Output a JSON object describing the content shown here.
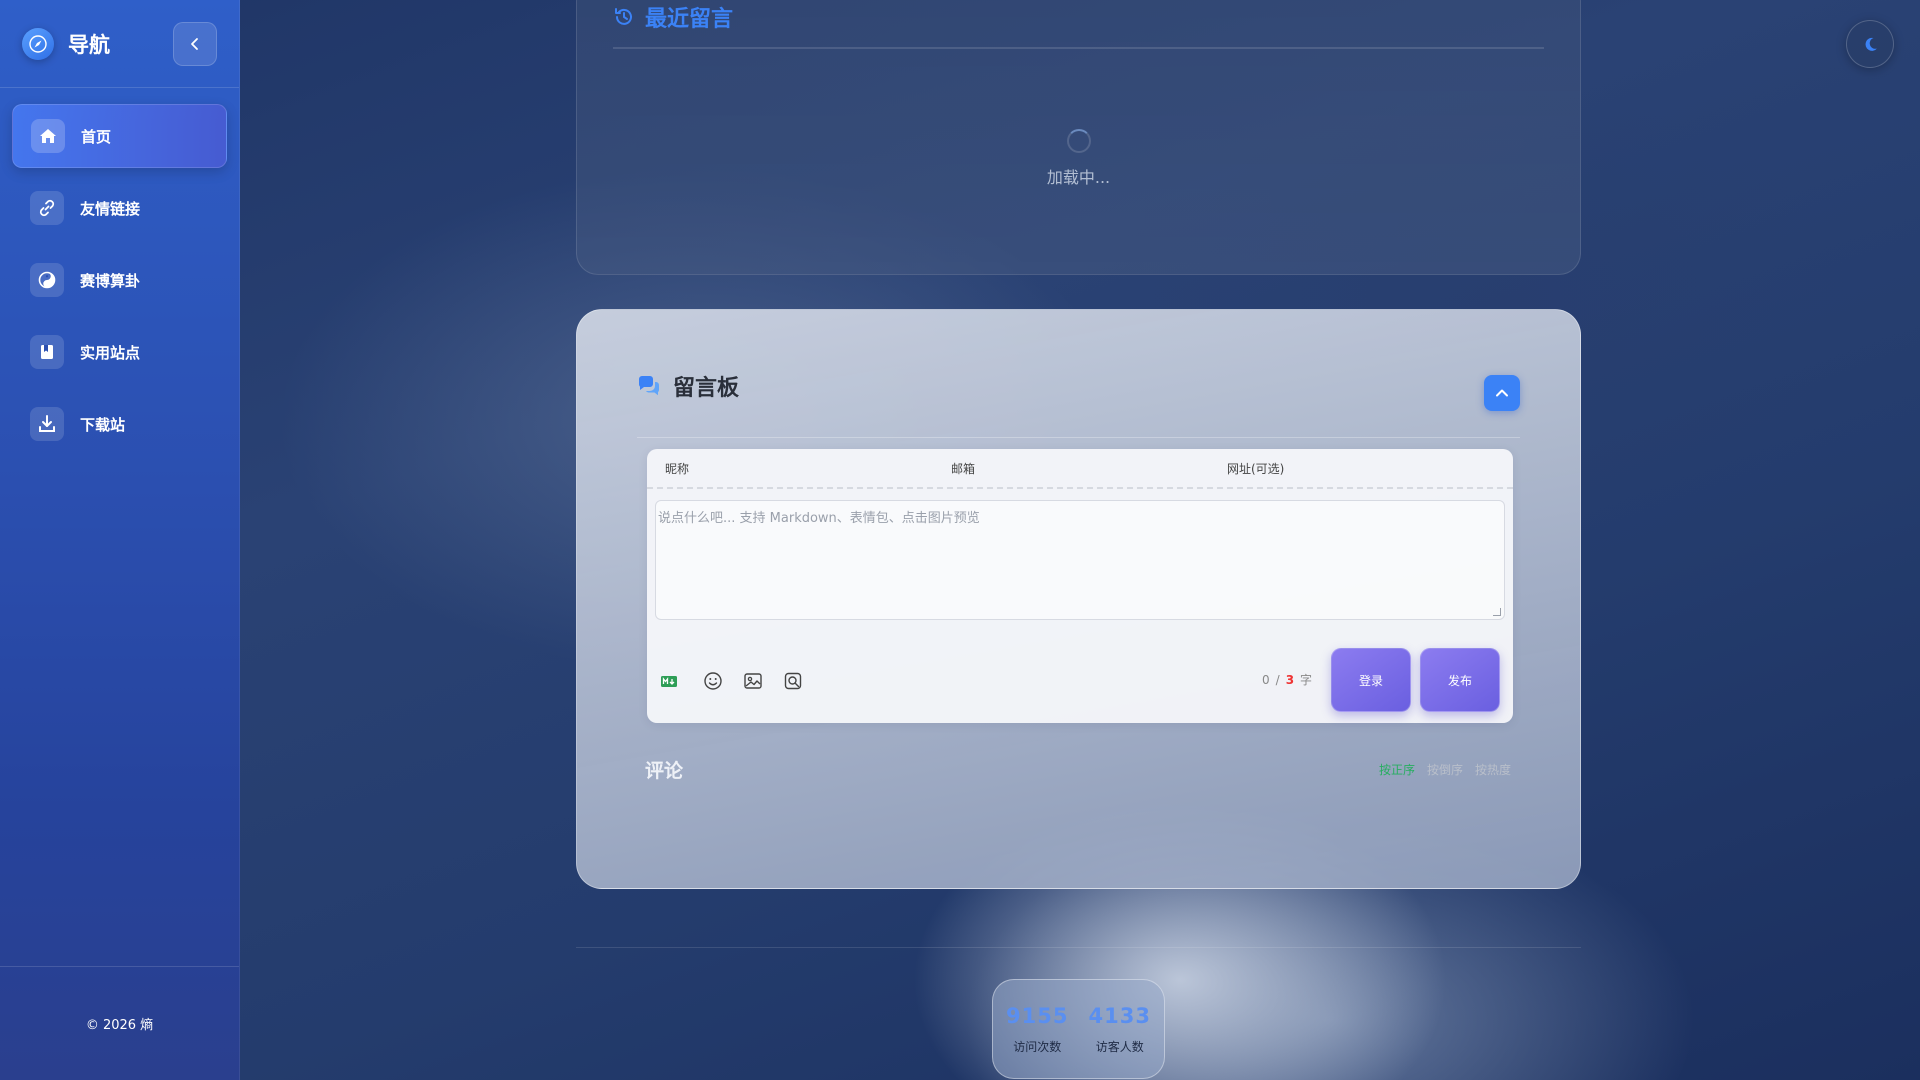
{
  "sidebar": {
    "brand": "导航",
    "items": [
      {
        "label": "首页",
        "icon": "home-icon",
        "active": true
      },
      {
        "label": "友情链接",
        "icon": "link-icon",
        "active": false
      },
      {
        "label": "赛博算卦",
        "icon": "yin-yang-icon",
        "active": false
      },
      {
        "label": "实用站点",
        "icon": "bookmark-icon",
        "active": false
      },
      {
        "label": "下载站",
        "icon": "download-icon",
        "active": false
      }
    ],
    "footer": "© 2026 熵"
  },
  "recent": {
    "title": "最近留言",
    "loading_text": "加载中..."
  },
  "board": {
    "title": "留言板",
    "fields": {
      "nickname": "昵称",
      "email": "邮箱",
      "website": "网址(可选)"
    },
    "textarea_placeholder": "说点什么吧... 支持 Markdown、表情包、点击图片预览",
    "counter": {
      "current": "0",
      "separator": "/",
      "max": "3",
      "unit": "字"
    },
    "login_label": "登录",
    "publish_label": "发布",
    "comments_title": "评论",
    "sort": {
      "asc": "按正序",
      "desc": "按倒序",
      "hot": "按热度"
    },
    "colors": {
      "accent": "#3b82f6",
      "active_sort": "#27ae60",
      "button": "#7a6de8"
    }
  },
  "stats": {
    "visits_value": "9155",
    "visits_label": "访问次数",
    "visitors_value": "4133",
    "visitors_label": "访客人数"
  }
}
